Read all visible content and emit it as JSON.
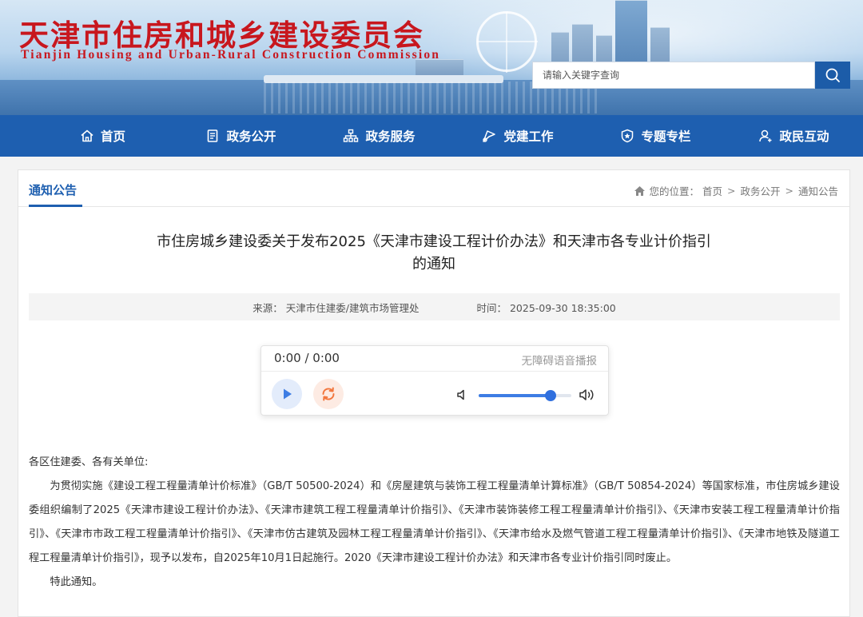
{
  "header": {
    "title_cn": "天津市住房和城乡建设委员会",
    "title_en": "Tianjin Housing and Urban-Rural Construction Commission",
    "search_placeholder": "请输入关键字查询"
  },
  "nav": {
    "items": [
      {
        "label": "首页",
        "icon": "home-icon"
      },
      {
        "label": "政务公开",
        "icon": "document-icon"
      },
      {
        "label": "政务服务",
        "icon": "org-icon"
      },
      {
        "label": "党建工作",
        "icon": "flag-icon"
      },
      {
        "label": "专题专栏",
        "icon": "badge-icon"
      },
      {
        "label": "政民互动",
        "icon": "user-icon"
      }
    ]
  },
  "section": {
    "title": "通知公告",
    "breadcrumb": {
      "prefix": "您的位置：",
      "items": [
        "首页",
        "政务公开",
        "通知公告"
      ],
      "separator": ">"
    }
  },
  "article": {
    "title_line1": "市住房城乡建设委关于发布2025《天津市建设工程计价办法》和天津市各专业计价指引",
    "title_line2": "的通知",
    "source_label": "来源：",
    "source": "天津市住建委/建筑市场管理处",
    "time_label": "时间：",
    "time": "2025-09-30 18:35:00",
    "salutation": "各区住建委、各有关单位:",
    "paragraph1": "为贯彻实施《建设工程工程量清单计价标准》（GB/T 50500-2024）和《房屋建筑与装饰工程工程量清单计算标准》（GB/T 50854-2024）等国家标准，市住房城乡建设委组织编制了2025《天津市建设工程计价办法》、《天津市建筑工程工程量清单计价指引》、《天津市装饰装修工程工程量清单计价指引》、《天津市安装工程工程量清单计价指引》、《天津市市政工程工程量清单计价指引》、《天津市仿古建筑及园林工程工程量清单计价指引》、《天津市给水及燃气管道工程工程量清单计价指引》、《天津市地铁及隧道工程工程量清单计价指引》，现予以发布，自2025年10月1日起施行。2020《天津市建设工程计价办法》和天津市各专业计价指引同时废止。",
    "closing": "特此通知。"
  },
  "player": {
    "time_display": "0:00 / 0:00",
    "label": "无障碍语音播报",
    "volume": 0.78
  },
  "colors": {
    "brand_red": "#c8171e",
    "nav_blue": "#1e5fb0",
    "accent_blue": "#2f6fde"
  }
}
